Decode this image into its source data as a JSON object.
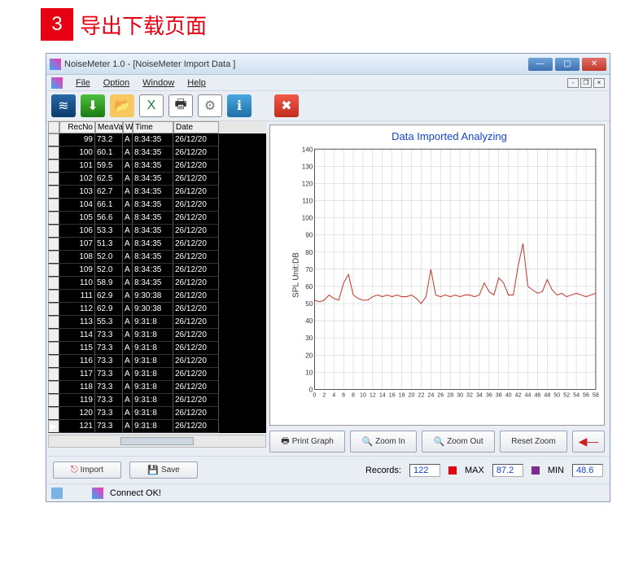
{
  "page": {
    "step": "3",
    "title": "导出下载页面"
  },
  "window": {
    "title": "NoiseMeter 1.0  -  [NoiseMeter Import Data ]"
  },
  "menu": {
    "file": "File",
    "option": "Option",
    "window": "Window",
    "help": "Help"
  },
  "table": {
    "headers": {
      "recno": "RecNo",
      "meaval": "MeaVal",
      "w": "W",
      "time": "Time",
      "date": "Date"
    },
    "rows": [
      {
        "recno": "99",
        "val": "73.2",
        "w": "A",
        "time": "8:34:35",
        "date": "26/12/20"
      },
      {
        "recno": "100",
        "val": "60.1",
        "w": "A",
        "time": "8:34:35",
        "date": "26/12/20"
      },
      {
        "recno": "101",
        "val": "59.5",
        "w": "A",
        "time": "8:34:35",
        "date": "26/12/20"
      },
      {
        "recno": "102",
        "val": "62.5",
        "w": "A",
        "time": "8:34:35",
        "date": "26/12/20"
      },
      {
        "recno": "103",
        "val": "62.7",
        "w": "A",
        "time": "8:34:35",
        "date": "26/12/20"
      },
      {
        "recno": "104",
        "val": "66.1",
        "w": "A",
        "time": "8:34:35",
        "date": "26/12/20"
      },
      {
        "recno": "105",
        "val": "56.6",
        "w": "A",
        "time": "8:34:35",
        "date": "26/12/20"
      },
      {
        "recno": "106",
        "val": "53.3",
        "w": "A",
        "time": "8:34:35",
        "date": "26/12/20"
      },
      {
        "recno": "107",
        "val": "51.3",
        "w": "A",
        "time": "8:34:35",
        "date": "26/12/20"
      },
      {
        "recno": "108",
        "val": "52.0",
        "w": "A",
        "time": "8:34:35",
        "date": "26/12/20"
      },
      {
        "recno": "109",
        "val": "52.0",
        "w": "A",
        "time": "8:34:35",
        "date": "26/12/20"
      },
      {
        "recno": "110",
        "val": "58.9",
        "w": "A",
        "time": "8:34:35",
        "date": "26/12/20"
      },
      {
        "recno": "111",
        "val": "62.9",
        "w": "A",
        "time": "9:30:38",
        "date": "26/12/20"
      },
      {
        "recno": "112",
        "val": "62.9",
        "w": "A",
        "time": "9:30:38",
        "date": "26/12/20"
      },
      {
        "recno": "113",
        "val": "55.3",
        "w": "A",
        "time": "9:31:8",
        "date": "26/12/20"
      },
      {
        "recno": "114",
        "val": "73.3",
        "w": "A",
        "time": "9:31:8",
        "date": "26/12/20"
      },
      {
        "recno": "115",
        "val": "73.3",
        "w": "A",
        "time": "9:31:8",
        "date": "26/12/20"
      },
      {
        "recno": "116",
        "val": "73.3",
        "w": "A",
        "time": "9:31:8",
        "date": "26/12/20"
      },
      {
        "recno": "117",
        "val": "73.3",
        "w": "A",
        "time": "9:31:8",
        "date": "26/12/20"
      },
      {
        "recno": "118",
        "val": "73.3",
        "w": "A",
        "time": "9:31:8",
        "date": "26/12/20"
      },
      {
        "recno": "119",
        "val": "73.3",
        "w": "A",
        "time": "9:31:8",
        "date": "26/12/20"
      },
      {
        "recno": "120",
        "val": "73.3",
        "w": "A",
        "time": "9:31:8",
        "date": "26/12/20"
      },
      {
        "recno": "121",
        "val": "73.3",
        "w": "A",
        "time": "9:31:8",
        "date": "26/12/20"
      }
    ]
  },
  "chart": {
    "title": "Data Imported  Analyzing",
    "ylabel": "SPL  Unit:DB"
  },
  "chart_data": {
    "type": "line",
    "title": "Data Imported  Analyzing",
    "xlabel": "",
    "ylabel": "SPL  Unit:DB",
    "ylim": [
      0,
      140
    ],
    "xlim": [
      0,
      58
    ],
    "x": [
      0,
      1,
      2,
      3,
      4,
      5,
      6,
      7,
      8,
      9,
      10,
      11,
      12,
      13,
      14,
      15,
      16,
      17,
      18,
      19,
      20,
      21,
      22,
      23,
      24,
      25,
      26,
      27,
      28,
      29,
      30,
      31,
      32,
      33,
      34,
      35,
      36,
      37,
      38,
      39,
      40,
      41,
      42,
      43,
      44,
      45,
      46,
      47,
      48,
      49,
      50,
      51,
      52,
      53,
      54,
      55,
      56,
      57,
      58
    ],
    "values": [
      52,
      51,
      52,
      55,
      53,
      52,
      62,
      67,
      55,
      53,
      52,
      52,
      54,
      55,
      54,
      55,
      54,
      55,
      54,
      54,
      55,
      53,
      50,
      54,
      70,
      55,
      54,
      55,
      54,
      55,
      54,
      55,
      55,
      54,
      55,
      62,
      57,
      55,
      65,
      62,
      55,
      55,
      72,
      85,
      60,
      58,
      56,
      57,
      64,
      58,
      55,
      56,
      54,
      55,
      56,
      55,
      54,
      55,
      56
    ]
  },
  "chart_buttons": {
    "print": "Print Graph",
    "zoomin": "Zoom In",
    "zoomout": "Zoom Out",
    "reset": "Reset Zoom"
  },
  "bottom": {
    "import": "Import",
    "save": "Save",
    "records_label": "Records:",
    "records": "122",
    "max_label": "MAX",
    "max": "87.2",
    "min_label": "MIN",
    "min": "48.6"
  },
  "status": {
    "text": "Connect OK!"
  }
}
